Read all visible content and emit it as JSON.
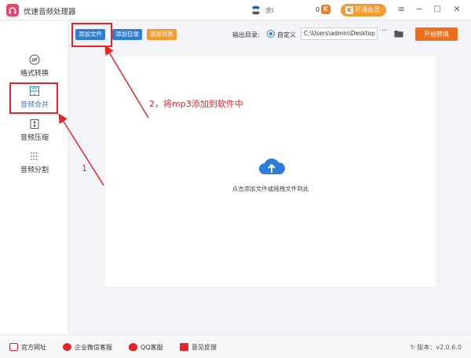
{
  "app": {
    "title": "优速音频处理器"
  },
  "header": {
    "username": "余l",
    "coins": "0",
    "coin_badge": "K",
    "vip_button": "开通会员",
    "vip_badge": "K",
    "controls": [
      "≡",
      "−",
      "□",
      "✕"
    ]
  },
  "sidebar": {
    "items": [
      {
        "label": "格式转换",
        "icon": "convert-icon",
        "active": false
      },
      {
        "label": "音频合并",
        "icon": "merge-icon",
        "active": true
      },
      {
        "label": "音频压缩",
        "icon": "compress-icon",
        "active": false
      },
      {
        "label": "音频分割",
        "icon": "split-icon",
        "active": false
      }
    ]
  },
  "toolbar": {
    "add_file": "添加文件",
    "add_folder": "添加目录",
    "clear_list": "清除列表",
    "output_label": "输出目录:",
    "radio_label": "自定义",
    "output_path": "C:\\Users\\admin\\Desktop",
    "more": "···",
    "start": "开始转换"
  },
  "drop_area": {
    "hint": "点击添加文件或拖拽文件到此"
  },
  "annotations": {
    "step1": "1",
    "step2": "2，将mp3添加到软件中"
  },
  "footer": {
    "links": [
      "官方网址",
      "企业微信客服",
      "QQ客服",
      "意见反馈"
    ],
    "version": "版本：v2.0.6.0"
  },
  "colors": {
    "accent_blue": "#2d7cd8",
    "start_orange": "#f06d1a",
    "vip_orange": "#f79a2d",
    "annotation_red": "#e8242a",
    "logo_pink": "#ef3f6a"
  }
}
